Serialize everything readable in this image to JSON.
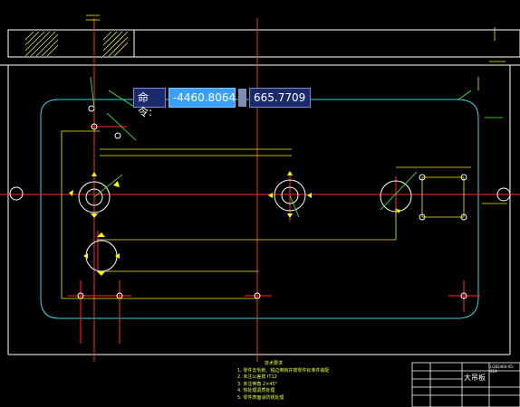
{
  "command": {
    "prompt": "命令:",
    "x_value": "-4460.8064",
    "y_value": "665.7709"
  },
  "notes": {
    "title": "技术要求",
    "items": [
      "1. 零件去毛刺、锐边倒钝并按零件标准件装配",
      "2. 未注公差按 IT12",
      "3. 未注倒角 2×45°",
      "4. 热处理调质处理",
      "5. 零件表面涂防锈处理"
    ]
  },
  "title_block": {
    "part_name": "大吊板",
    "drawing_code": "LGB2460-05-019"
  },
  "colors": {
    "background": "#000000",
    "outline": "#ffffff",
    "dimension": "#ffff00",
    "centerline": "#ff0000",
    "slot": "#00ffff",
    "leader": "#00ff00",
    "hatch": "#ffff66"
  }
}
